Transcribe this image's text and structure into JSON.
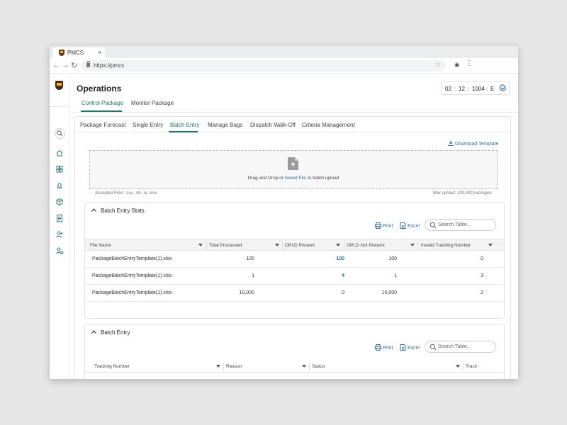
{
  "browser": {
    "tab_title": "PMCS",
    "tab_close": "×",
    "url": "https://pmcs",
    "back_icon": "arrow-left-icon",
    "forward_icon": "arrow-right-icon",
    "reload_icon": "reload-icon"
  },
  "app": {
    "title": "Operations",
    "date": {
      "month": "02",
      "day": "12",
      "code": "1004",
      "letter": "E"
    },
    "page_tabs": [
      {
        "label": "Control Package",
        "active": true
      },
      {
        "label": "Monitor Package",
        "active": false
      }
    ]
  },
  "sidebar": {
    "icons": [
      "search-icon",
      "home-icon",
      "dashboard-icon",
      "bell-icon",
      "package-icon",
      "clipboard-icon",
      "add-user-icon",
      "user-settings-icon",
      "profile-icon"
    ]
  },
  "subtabs": [
    {
      "label": "Package Forecast",
      "active": false
    },
    {
      "label": "Single Entry",
      "active": false
    },
    {
      "label": "Batch Entry",
      "active": true
    },
    {
      "label": "Manage Bags",
      "active": false
    },
    {
      "label": "Dispatch Walk-Off",
      "active": false
    },
    {
      "label": "Criteria Management",
      "active": false
    }
  ],
  "upload": {
    "download_label": "Download Template",
    "drop_text_before": "Drag and Drop or ",
    "drop_link": "Select File",
    "drop_text_after": " to batch upload",
    "accepted": "Accepted Files: .csv, .xls, or .xlsx",
    "max_upload": "Max upload: 100,000 packages"
  },
  "stats": {
    "title": "Batch Entry Stats",
    "print_label": "Print",
    "excel_label": "Excel",
    "search_placeholder": "Search Table...",
    "columns": [
      "File Name",
      "Total Processed",
      "OPLD Present",
      "OPLD Not Present",
      "Invalid Tracking Number"
    ],
    "rows": [
      {
        "file": "PackageBatchEntryTemplate(1).xlsx",
        "total": "100",
        "opld": "100",
        "not_present": "100",
        "invalid": "0"
      },
      {
        "file": "PackageBatchEntryTemplate(1).xlsx",
        "total": "1",
        "opld": "4",
        "not_present": "1",
        "invalid": "3"
      },
      {
        "file": "PackageBatchEntryTemplate(1).xlsx",
        "total": "10,000",
        "opld": "0",
        "not_present": "10,000",
        "invalid": "2"
      }
    ]
  },
  "batch": {
    "title": "Batch Entry",
    "print_label": "Print",
    "excel_label": "Excel",
    "search_placeholder": "Search Table...",
    "columns": [
      "Tracking Number",
      "Reason",
      "Status",
      "Track"
    ]
  },
  "colors": {
    "accent": "#16766f",
    "link": "#2e6da4",
    "brand_brown": "#4a2511",
    "brand_gold": "#ffb500"
  }
}
